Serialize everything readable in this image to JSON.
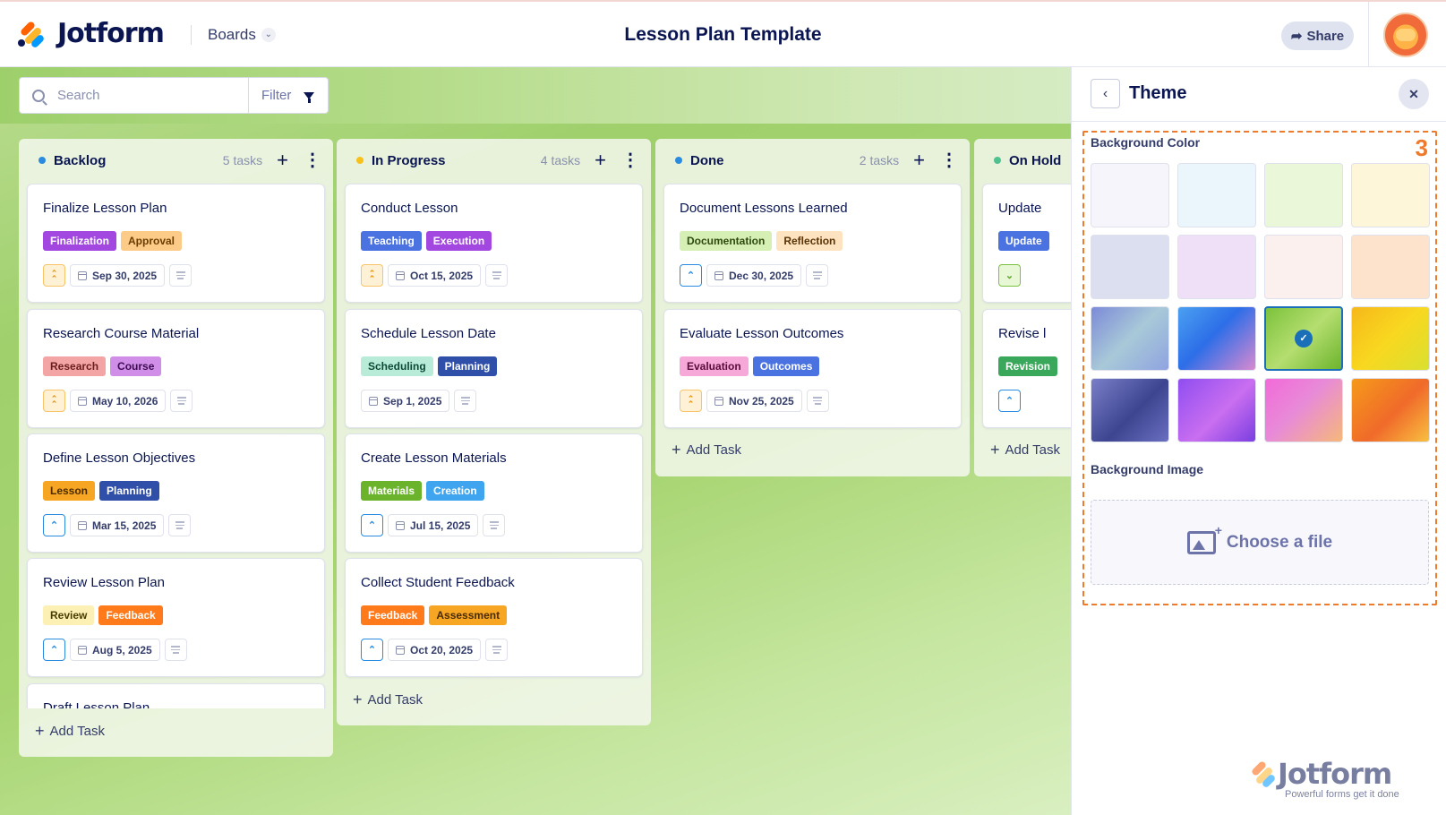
{
  "header": {
    "brand": "Jotform",
    "boards_label": "Boards",
    "title": "Lesson Plan Template",
    "share_label": "Share"
  },
  "toolbar": {
    "search_placeholder": "Search",
    "filter_label": "Filter"
  },
  "columns": [
    {
      "title": "Backlog",
      "count": "5 tasks",
      "dot_color": "#2a8be0",
      "add_task": "Add Task",
      "cards": [
        {
          "title": "Finalize Lesson Plan",
          "tags": [
            {
              "label": "Finalization",
              "bg": "#a248e0",
              "fg": "#ffffff"
            },
            {
              "label": "Approval",
              "bg": "#fccb87",
              "fg": "#6b3d00"
            }
          ],
          "priority": "high",
          "date": "Sep 30, 2025"
        },
        {
          "title": "Research Course Material",
          "tags": [
            {
              "label": "Research",
              "bg": "#f3a5a5",
              "fg": "#6b1d1d"
            },
            {
              "label": "Course",
              "bg": "#d08ee8",
              "fg": "#3d0b52"
            }
          ],
          "priority": "high",
          "date": "May 10, 2026"
        },
        {
          "title": "Define Lesson Objectives",
          "tags": [
            {
              "label": "Lesson",
              "bg": "#f6a623",
              "fg": "#4a2b00"
            },
            {
              "label": "Planning",
              "bg": "#2f4fa8",
              "fg": "#ffffff"
            }
          ],
          "priority": "med",
          "date": "Mar 15, 2025"
        },
        {
          "title": "Review Lesson Plan",
          "tags": [
            {
              "label": "Review",
              "bg": "#fdf0b5",
              "fg": "#4a3d00"
            },
            {
              "label": "Feedback",
              "bg": "#ff7a1a",
              "fg": "#ffffff"
            }
          ],
          "priority": "med",
          "date": "Aug 5, 2025"
        },
        {
          "title": "Draft Lesson Plan",
          "tags": [],
          "priority": "",
          "date": ""
        }
      ]
    },
    {
      "title": "In Progress",
      "count": "4 tasks",
      "dot_color": "#f6c21a",
      "add_task": "Add Task",
      "cards": [
        {
          "title": "Conduct Lesson",
          "tags": [
            {
              "label": "Teaching",
              "bg": "#4a72e0",
              "fg": "#ffffff"
            },
            {
              "label": "Execution",
              "bg": "#a248e0",
              "fg": "#ffffff"
            }
          ],
          "priority": "high",
          "date": "Oct 15, 2025"
        },
        {
          "title": "Schedule Lesson Date",
          "tags": [
            {
              "label": "Scheduling",
              "bg": "#b8ecd9",
              "fg": "#0d4a36"
            },
            {
              "label": "Planning",
              "bg": "#2f4fa8",
              "fg": "#ffffff"
            }
          ],
          "priority": "",
          "date": "Sep 1, 2025"
        },
        {
          "title": "Create Lesson Materials",
          "tags": [
            {
              "label": "Materials",
              "bg": "#6cb32c",
              "fg": "#ffffff"
            },
            {
              "label": "Creation",
              "bg": "#3ea5ee",
              "fg": "#ffffff"
            }
          ],
          "priority": "med",
          "date": "Jul 15, 2025"
        },
        {
          "title": "Collect Student Feedback",
          "tags": [
            {
              "label": "Feedback",
              "bg": "#ff7a1a",
              "fg": "#ffffff"
            },
            {
              "label": "Assessment",
              "bg": "#f6a623",
              "fg": "#4a2b00"
            }
          ],
          "priority": "med",
          "date": "Oct 20, 2025"
        }
      ]
    },
    {
      "title": "Done",
      "count": "2 tasks",
      "dot_color": "#2a8be0",
      "add_task": "Add Task",
      "cards": [
        {
          "title": "Document Lessons Learned",
          "tags": [
            {
              "label": "Documentation",
              "bg": "#d6efb4",
              "fg": "#2e4a0d"
            },
            {
              "label": "Reflection",
              "bg": "#fde3c0",
              "fg": "#5a3306"
            }
          ],
          "priority": "med",
          "date": "Dec 30, 2025"
        },
        {
          "title": "Evaluate Lesson Outcomes",
          "tags": [
            {
              "label": "Evaluation",
              "bg": "#f6a9d9",
              "fg": "#5a0b3c"
            },
            {
              "label": "Outcomes",
              "bg": "#4a72e0",
              "fg": "#ffffff"
            }
          ],
          "priority": "high",
          "date": "Nov 25, 2025"
        }
      ]
    },
    {
      "title": "On Hold",
      "count": "",
      "dot_color": "#4fc28f",
      "add_task": "Add Task",
      "cards": [
        {
          "title": "Update",
          "tags": [
            {
              "label": "Update",
              "bg": "#4a72e0",
              "fg": "#ffffff"
            }
          ],
          "priority": "low",
          "date": ""
        },
        {
          "title": "Revise l",
          "tags": [
            {
              "label": "Revision",
              "bg": "#3aa85a",
              "fg": "#ffffff"
            }
          ],
          "priority": "med",
          "date": ""
        }
      ]
    }
  ],
  "theme_panel": {
    "title": "Theme",
    "step_number": "3",
    "background_color_label": "Background Color",
    "background_image_label": "Background Image",
    "choose_file_label": "Choose a file",
    "selected_swatch_index": 10,
    "swatches": [
      "#f5f5fb",
      "#eaf6fc",
      "#eaf7d9",
      "#fdf6d9",
      "#dcdff0",
      "#efe0f8",
      "#fcf0ee",
      "#fde3cb",
      "linear-gradient(135deg,#7c8ad8,#a8c9d8 50%,#8fa3e0)",
      "linear-gradient(135deg,#4aa0f0,#2d6ee8 45%,#d98ad0)",
      "linear-gradient(135deg,#7cc23c,#b5de70 50%,#6cb42c)",
      "linear-gradient(135deg,#f6b81a,#f8d820 50%,#d9e030)",
      "linear-gradient(135deg,#7a7ec8,#3d4590 55%,#6a6fc0)",
      "linear-gradient(135deg,#8f4ef0,#c96ef0 55%,#7a3ee0)",
      "linear-gradient(135deg,#f26ad8,#e88ad8 45%,#f5b87a)",
      "linear-gradient(135deg,#f59a1a,#f06a2a 55%,#f8c040)"
    ]
  },
  "watermark": {
    "brand": "Jotform",
    "tagline": "Powerful forms get it done"
  },
  "colors": {
    "navy": "#0a1551",
    "accent_orange": "#ee7b2d",
    "selected_blue": "#1b6fb8"
  }
}
